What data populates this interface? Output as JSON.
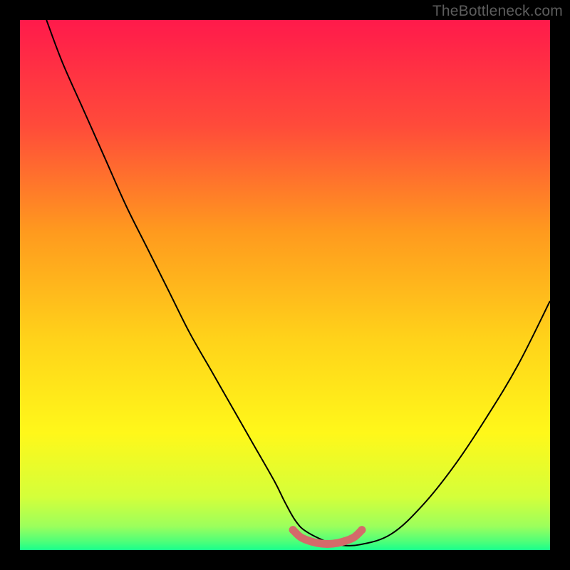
{
  "watermark": "TheBottleneck.com",
  "chart_data": {
    "type": "line",
    "title": "",
    "xlabel": "",
    "ylabel": "",
    "xlim": [
      0,
      100
    ],
    "ylim": [
      0,
      100
    ],
    "grid": false,
    "legend": false,
    "background_gradient": {
      "stops": [
        {
          "offset": 0.0,
          "color": "#ff1a4b"
        },
        {
          "offset": 0.2,
          "color": "#ff4b3a"
        },
        {
          "offset": 0.4,
          "color": "#ff9a1e"
        },
        {
          "offset": 0.6,
          "color": "#ffd21a"
        },
        {
          "offset": 0.78,
          "color": "#fff81a"
        },
        {
          "offset": 0.9,
          "color": "#d4ff3a"
        },
        {
          "offset": 0.955,
          "color": "#9cff5c"
        },
        {
          "offset": 0.985,
          "color": "#4bff7a"
        },
        {
          "offset": 1.0,
          "color": "#1aff8c"
        }
      ]
    },
    "series": [
      {
        "name": "bottleneck-curve",
        "color": "#000000",
        "width": 2.0,
        "x": [
          5,
          8,
          12,
          16,
          20,
          24,
          28,
          32,
          36,
          40,
          44,
          48,
          50,
          52,
          54,
          58,
          60,
          64,
          70,
          76,
          82,
          88,
          94,
          100
        ],
        "values": [
          100,
          92,
          83,
          74,
          65,
          57,
          49,
          41,
          34,
          27,
          20,
          13,
          9,
          5.5,
          3.5,
          1.5,
          1.0,
          1.0,
          3.0,
          8.5,
          16,
          25,
          35,
          47
        ]
      },
      {
        "name": "optimal-range-marker",
        "color": "#d46a6a",
        "width": 11,
        "linecap": "round",
        "x": [
          51.5,
          53,
          55,
          57,
          59,
          61,
          63,
          64.5
        ],
        "values": [
          3.8,
          2.4,
          1.6,
          1.2,
          1.2,
          1.6,
          2.4,
          3.8
        ]
      }
    ]
  }
}
